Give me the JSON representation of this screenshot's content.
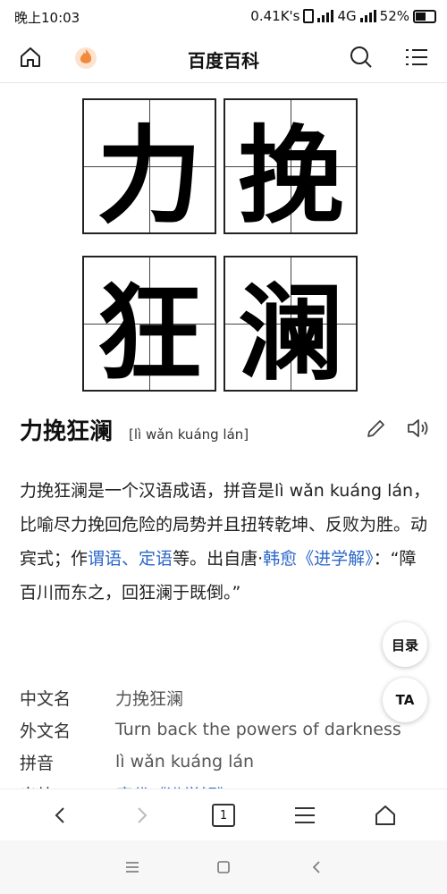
{
  "status_bar": {
    "time": "晚上10:03",
    "speed": "0.41K's",
    "network": "4G",
    "battery": "52%"
  },
  "header": {
    "title": "百度百科",
    "icons": [
      "home-icon",
      "flame-icon",
      "search-icon",
      "menu-icon"
    ]
  },
  "calligraphy": [
    "力",
    "挽",
    "狂",
    "澜"
  ],
  "term": {
    "word": "力挽狂澜",
    "pinyin": "[lì wǎn kuáng lán]"
  },
  "summary": {
    "p1": "力挽狂澜是一个汉语成语，拼音是lì wǎn kuáng lán，比喻尽力挽回危险的局势并且扭转乾坤、反败为胜。动宾式；作",
    "link1": "谓语",
    "sep": "、",
    "link2": "定语",
    "p2": "等。出自唐·",
    "link3": "韩愈",
    "q_open": "《",
    "link4": "进学解",
    "q_close": "》",
    "p3": "：“障百川而东之，回狂澜于既倒。”"
  },
  "info": [
    {
      "key": "中文名",
      "value": "力挽狂澜"
    },
    {
      "key": "外文名",
      "value": "Turn back the powers of darkness"
    },
    {
      "key": "拼音",
      "value": "lì wǎn kuáng lán"
    },
    {
      "key": "出处",
      "value": "唐代《进学解》"
    }
  ],
  "floating": {
    "toc": "目录",
    "ta": "TA"
  },
  "toolbar": {
    "page_count": "1"
  },
  "colors": {
    "link": "#2b67c8",
    "flame": "#f08a3c"
  }
}
